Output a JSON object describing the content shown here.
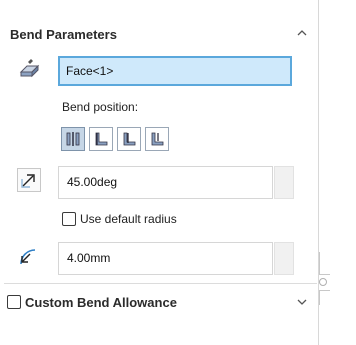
{
  "section_bend": {
    "title": "Bend Parameters",
    "face_value": "Face<1>",
    "bend_position_label": "Bend position:",
    "bend_position_options": [
      "bend-centerline",
      "material-inside",
      "material-outside",
      "bend-outside"
    ],
    "selected_bend_position": "bend-centerline",
    "angle_value": "45.00deg",
    "use_default_radius_label": "Use default radius",
    "use_default_radius_checked": false,
    "radius_value": "4.00mm"
  },
  "section_allowance": {
    "title": "Custom Bend Allowance",
    "checked": false
  },
  "colors": {
    "accent": "#5ba8dc",
    "face_bg": "#cfe9fb",
    "selected_button": "#c6d6e6"
  }
}
